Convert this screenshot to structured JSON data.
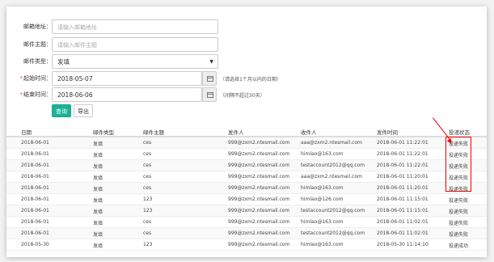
{
  "form": {
    "email": {
      "label": "邮箱地址：",
      "placeholder": "请输入邮箱地址"
    },
    "subject": {
      "label": "邮件主题：",
      "placeholder": "请输入邮件主题"
    },
    "type": {
      "label": "邮件类型：",
      "value": "发填"
    },
    "start": {
      "required_mark": "*",
      "label": "起始时间：",
      "value": "2018-05-07",
      "hint": "（请选择1个月以内的日期）"
    },
    "end": {
      "required_mark": "*",
      "label": "结束时间：",
      "value": "2018-06-06",
      "hint": "（间隔不超过30天）"
    },
    "query_label": "查询",
    "export_label": "导出"
  },
  "table": {
    "headers": [
      "日期",
      "邮件类型",
      "邮件主题",
      "发件人",
      "收件人",
      "发件时间",
      "投递状态"
    ],
    "rows": [
      [
        "2018-06-01",
        "发填",
        "ces",
        "999@zxm2.ntesmail.com",
        "aaa@zxm2.ntesmail.com",
        "2018-06-01 11:22:01",
        "投递失败"
      ],
      [
        "2018-06-01",
        "发填",
        "ces",
        "999@zxm2.ntesmail.com",
        "himlao@163.com",
        "2018-06-01 11:22:01",
        "投递失败"
      ],
      [
        "2018-06-01",
        "发填",
        "ces",
        "999@zxm2.ntesmail.com",
        "testaccount2012@qq.com",
        "2018-06-01 11:22:01",
        "投递失败"
      ],
      [
        "2018-06-01",
        "发填",
        "ces",
        "999@zxm2.ntesmail.com",
        "aaa@zxm2.ntesmail.com",
        "2018-06-01 11:20:01",
        "投递失败"
      ],
      [
        "2018-06-01",
        "发填",
        "ces",
        "999@zxm2.ntesmail.com",
        "himlao@163.com",
        "2018-06-01 11:20:01",
        "投递失败"
      ],
      [
        "2018-06-01",
        "发填",
        "123",
        "999@zxm2.ntesmail.com",
        "himlao@126.com",
        "2018-06-01 11:15:01",
        "投递失败"
      ],
      [
        "2018-06-01",
        "发填",
        "123",
        "999@zxm2.ntesmail.com",
        "testaccount2012@qq.com",
        "2018-06-01 11:15:01",
        "投递失败"
      ],
      [
        "2018-06-01",
        "发填",
        "ces",
        "999@zxm2.ntesmail.com",
        "himlao@163.com",
        "2018-06-01 11:02:01",
        "投递失败"
      ],
      [
        "2018-06-01",
        "发填",
        "ces",
        "999@zxm2.ntesmail.com",
        "testaccount2012@qq.com",
        "2018-06-01 11:02:01",
        "投递失败"
      ],
      [
        "2018-05-30",
        "发填",
        "123",
        "999@zxm2.ntesmail.com",
        "himlao@163.com",
        "2018-05-30 11:14:10",
        "投递成功"
      ]
    ]
  },
  "colors": {
    "accent": "#1ab394",
    "annotation": "#ee0000"
  },
  "icons": {
    "date_picker": "calendar-icon",
    "select": "caret-down-icon"
  }
}
